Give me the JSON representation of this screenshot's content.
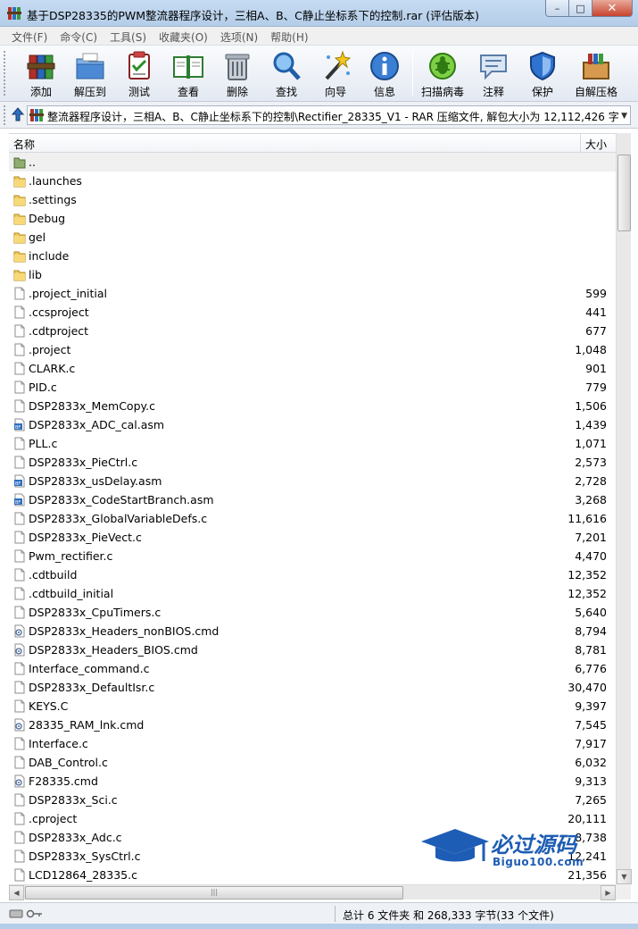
{
  "window": {
    "title": "基于DSP28335的PWM整流器程序设计，三相A、B、C静止坐标系下的控制.rar (评估版本)",
    "buttons": {
      "minimize": "–",
      "maximize": "□",
      "close": "✕"
    }
  },
  "menu": [
    "文件(F)",
    "命令(C)",
    "工具(S)",
    "收藏夹(O)",
    "选项(N)",
    "帮助(H)"
  ],
  "toolbar": {
    "buttons": [
      {
        "label": "添加",
        "icon": "add-archive-icon"
      },
      {
        "label": "解压到",
        "icon": "extract-to-icon"
      },
      {
        "label": "测试",
        "icon": "test-icon"
      },
      {
        "label": "查看",
        "icon": "view-icon"
      },
      {
        "label": "删除",
        "icon": "delete-icon"
      },
      {
        "label": "查找",
        "icon": "find-icon"
      },
      {
        "label": "向导",
        "icon": "wizard-icon"
      },
      {
        "label": "信息",
        "icon": "info-icon"
      },
      {
        "label": "扫描病毒",
        "icon": "virus-scan-icon"
      },
      {
        "label": "注释",
        "icon": "comment-icon"
      },
      {
        "label": "保护",
        "icon": "protect-icon"
      },
      {
        "label": "自解压格",
        "icon": "sfx-icon"
      }
    ]
  },
  "address": {
    "path": "整流器程序设计，三相A、B、C静止坐标系下的控制\\Rectifier_28335_V1 - RAR 压缩文件, 解包大小为 12,112,426 字节"
  },
  "columns": {
    "name": "名称",
    "size": "大小"
  },
  "files": [
    {
      "name": "..",
      "size": "",
      "type": "up"
    },
    {
      "name": ".launches",
      "size": "",
      "type": "folder"
    },
    {
      "name": ".settings",
      "size": "",
      "type": "folder"
    },
    {
      "name": "Debug",
      "size": "",
      "type": "folder"
    },
    {
      "name": "gel",
      "size": "",
      "type": "folder"
    },
    {
      "name": "include",
      "size": "",
      "type": "folder"
    },
    {
      "name": "lib",
      "size": "",
      "type": "folder"
    },
    {
      "name": ".project_initial",
      "size": "599",
      "type": "file"
    },
    {
      "name": ".ccsproject",
      "size": "441",
      "type": "file"
    },
    {
      "name": ".cdtproject",
      "size": "677",
      "type": "file"
    },
    {
      "name": ".project",
      "size": "1,048",
      "type": "file"
    },
    {
      "name": "CLARK.c",
      "size": "901",
      "type": "file"
    },
    {
      "name": "PID.c",
      "size": "779",
      "type": "file"
    },
    {
      "name": "DSP2833x_MemCopy.c",
      "size": "1,506",
      "type": "file"
    },
    {
      "name": "DSP2833x_ADC_cal.asm",
      "size": "1,439",
      "type": "asm"
    },
    {
      "name": "PLL.c",
      "size": "1,071",
      "type": "file"
    },
    {
      "name": "DSP2833x_PieCtrl.c",
      "size": "2,573",
      "type": "file"
    },
    {
      "name": "DSP2833x_usDelay.asm",
      "size": "2,728",
      "type": "asm"
    },
    {
      "name": "DSP2833x_CodeStartBranch.asm",
      "size": "3,268",
      "type": "asm"
    },
    {
      "name": "DSP2833x_GlobalVariableDefs.c",
      "size": "11,616",
      "type": "file"
    },
    {
      "name": "DSP2833x_PieVect.c",
      "size": "7,201",
      "type": "file"
    },
    {
      "name": "Pwm_rectifier.c",
      "size": "4,470",
      "type": "file"
    },
    {
      "name": ".cdtbuild",
      "size": "12,352",
      "type": "file"
    },
    {
      "name": ".cdtbuild_initial",
      "size": "12,352",
      "type": "file"
    },
    {
      "name": "DSP2833x_CpuTimers.c",
      "size": "5,640",
      "type": "file"
    },
    {
      "name": "DSP2833x_Headers_nonBIOS.cmd",
      "size": "8,794",
      "type": "cmd"
    },
    {
      "name": "DSP2833x_Headers_BIOS.cmd",
      "size": "8,781",
      "type": "cmd"
    },
    {
      "name": "Interface_command.c",
      "size": "6,776",
      "type": "file"
    },
    {
      "name": "DSP2833x_DefaultIsr.c",
      "size": "30,470",
      "type": "file"
    },
    {
      "name": "KEYS.C",
      "size": "9,397",
      "type": "file"
    },
    {
      "name": "28335_RAM_lnk.cmd",
      "size": "7,545",
      "type": "cmd"
    },
    {
      "name": "Interface.c",
      "size": "7,917",
      "type": "file"
    },
    {
      "name": "DAB_Control.c",
      "size": "6,032",
      "type": "file"
    },
    {
      "name": "F28335.cmd",
      "size": "9,313",
      "type": "cmd"
    },
    {
      "name": "DSP2833x_Sci.c",
      "size": "7,265",
      "type": "file"
    },
    {
      "name": ".cproject",
      "size": "20,111",
      "type": "file"
    },
    {
      "name": "DSP2833x_Adc.c",
      "size": "8,738",
      "type": "file"
    },
    {
      "name": "DSP2833x_SysCtrl.c",
      "size": "12,241",
      "type": "file"
    },
    {
      "name": "LCD12864_28335.c",
      "size": "21,356",
      "type": "file"
    }
  ],
  "status": {
    "text": "总计 6 文件夹 和 268,333 字节(33 个文件)"
  },
  "watermark": {
    "text": "必过源码",
    "sub": "Biguo100.com"
  },
  "colors": {
    "folder": "#e9c25a",
    "accent": "#1e5db5",
    "titlebar": "#c6dbf2"
  }
}
